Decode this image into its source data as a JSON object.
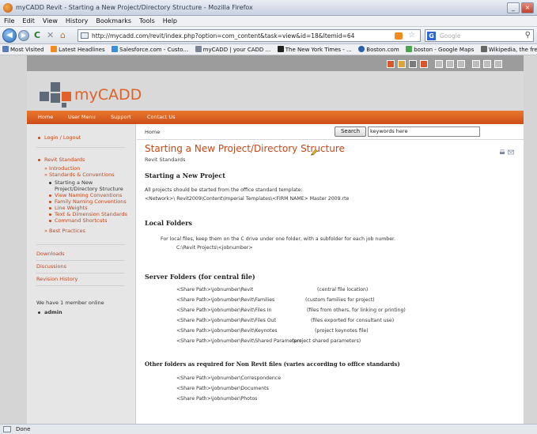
{
  "window": {
    "title": "myCADD Revit - Starting a New Project/Directory Structure - Mozilla Firefox",
    "minimize_glyph": "_",
    "close_glyph": "×"
  },
  "menu": [
    "File",
    "Edit",
    "View",
    "History",
    "Bookmarks",
    "Tools",
    "Help"
  ],
  "toolbar": {
    "url": "http://mycadd.com/revit/index.php?option=com_content&task=view&id=18&Itemid=64",
    "search_placeholder": "Google",
    "search_engine_glyph": "G"
  },
  "bookmarks": [
    {
      "label": "Most Visited",
      "color": "#5a7bbf"
    },
    {
      "label": "Latest Headlines",
      "color": "#f28c1e"
    },
    {
      "label": "Salesforce.com - Custo...",
      "color": "#3b8ed8"
    },
    {
      "label": "myCADD | your CADD ...",
      "color": "#7b8698"
    },
    {
      "label": "The New York Times - ...",
      "color": "#222222"
    },
    {
      "label": "Boston.com",
      "color": "#2a5fb0"
    },
    {
      "label": "boston - Google Maps",
      "color": "#46a84b"
    },
    {
      "label": "Wikipedia, the free enc...",
      "color": "#666666"
    }
  ],
  "site": {
    "logo_text": "myCADD",
    "nav": [
      "Home",
      "User Menu",
      "Support",
      "Contact Us"
    ],
    "accent_color": "#e0622a"
  },
  "sidebar": {
    "login": "Login / Logout",
    "revit_standards": "Revit Standards",
    "introduction": "Introduction",
    "standards_conventions": "Standards & Conventions",
    "sub_items": [
      "Starting a New",
      "Project/Directory Structure",
      "View Naming Conventions",
      "Family Naming Conventions",
      "Line Weights",
      "Text & Dimension Standards",
      "Command Shortcuts"
    ],
    "best_practices": "Best Practices",
    "downloads": "Downloads",
    "discussions": "Discussions",
    "revision_history": "Revision History",
    "online_text": "We have 1 member online",
    "online_user": "admin"
  },
  "content": {
    "breadcrumb": "Home",
    "search_button": "Search",
    "search_value": "keywords here",
    "title": "Starting a New Project/Directory Structure",
    "subtitle": "Revit Standards",
    "section1_heading": "Starting a New Project",
    "section1_text": "All projects should be started from the office standard template:",
    "section1_path": "<Network>\\ Revit2009\\Content\\Imperial Templates\\<FIRM NAME> Master 2009.rte",
    "section2_heading": "Local Folders",
    "section2_text": "For local files, keep them on the C drive under one folder, with a subfolder for each job number.",
    "section2_path": "C:\\Revit Projects\\<jobnumber>",
    "section3_heading": "Server Folders (for central file)",
    "server_folders": [
      {
        "path": "<Share Path>\\jobnumber\\Revit",
        "desc": "(central file location)"
      },
      {
        "path": "<Share Path>\\jobnumber\\Revit\\Families",
        "desc": "(custom families for project)"
      },
      {
        "path": "<Share Path>\\jobnumber\\Revit\\Files In",
        "desc": "(files from others, for linking or printing)"
      },
      {
        "path": "<Share Path>\\jobnumber\\Revit\\Files Out",
        "desc": "(files exported for consultant use)"
      },
      {
        "path": "<Share Path>\\jobnumber\\Revit\\Keynotes",
        "desc": "(project keynotes file)"
      },
      {
        "path": "<Share Path>\\jobnumber\\Revit\\Shared Parameters",
        "desc": "(project shared parameters)"
      }
    ],
    "section4_heading": "Other folders as required for Non Revit files (varies according to office standards)",
    "other_folders": [
      "<Share Path>\\jobnumber\\Correspondence",
      "<Share Path>\\jobnumber\\Documents",
      "<Share Path>\\jobnumber\\Photos"
    ]
  },
  "status": {
    "text": "Done"
  }
}
